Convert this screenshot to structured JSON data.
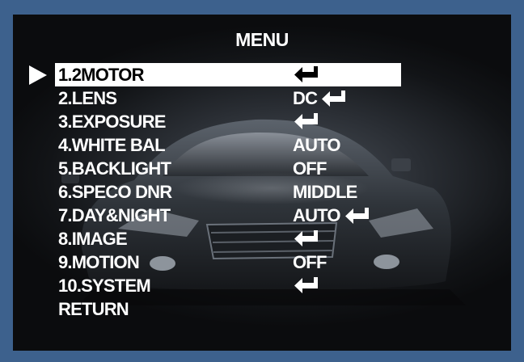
{
  "menu": {
    "title": "MENU",
    "items": [
      {
        "label": "1.2MOTOR",
        "value": "",
        "enter": true,
        "selected": true
      },
      {
        "label": "2.LENS",
        "value": "DC",
        "enter": true,
        "selected": false
      },
      {
        "label": "3.EXPOSURE",
        "value": "",
        "enter": true,
        "selected": false
      },
      {
        "label": "4.WHITE BAL",
        "value": "AUTO",
        "enter": false,
        "selected": false
      },
      {
        "label": "5.BACKLIGHT",
        "value": "OFF",
        "enter": false,
        "selected": false
      },
      {
        "label": "6.SPECO DNR",
        "value": "MIDDLE",
        "enter": false,
        "selected": false
      },
      {
        "label": "7.DAY&NIGHT",
        "value": "AUTO",
        "enter": true,
        "selected": false
      },
      {
        "label": "8.IMAGE",
        "value": "",
        "enter": true,
        "selected": false
      },
      {
        "label": "9.MOTION",
        "value": "OFF",
        "enter": false,
        "selected": false
      },
      {
        "label": "10.SYSTEM",
        "value": "",
        "enter": true,
        "selected": false
      },
      {
        "label": "RETURN",
        "value": "",
        "enter": false,
        "selected": false
      }
    ]
  },
  "colors": {
    "frame": "#3d618d",
    "text": "#ffffff",
    "highlight": "#ffffff",
    "highlight_text": "#000000"
  },
  "icons": {
    "cursor": "triangle-right-icon",
    "enter": "enter-return-icon"
  }
}
